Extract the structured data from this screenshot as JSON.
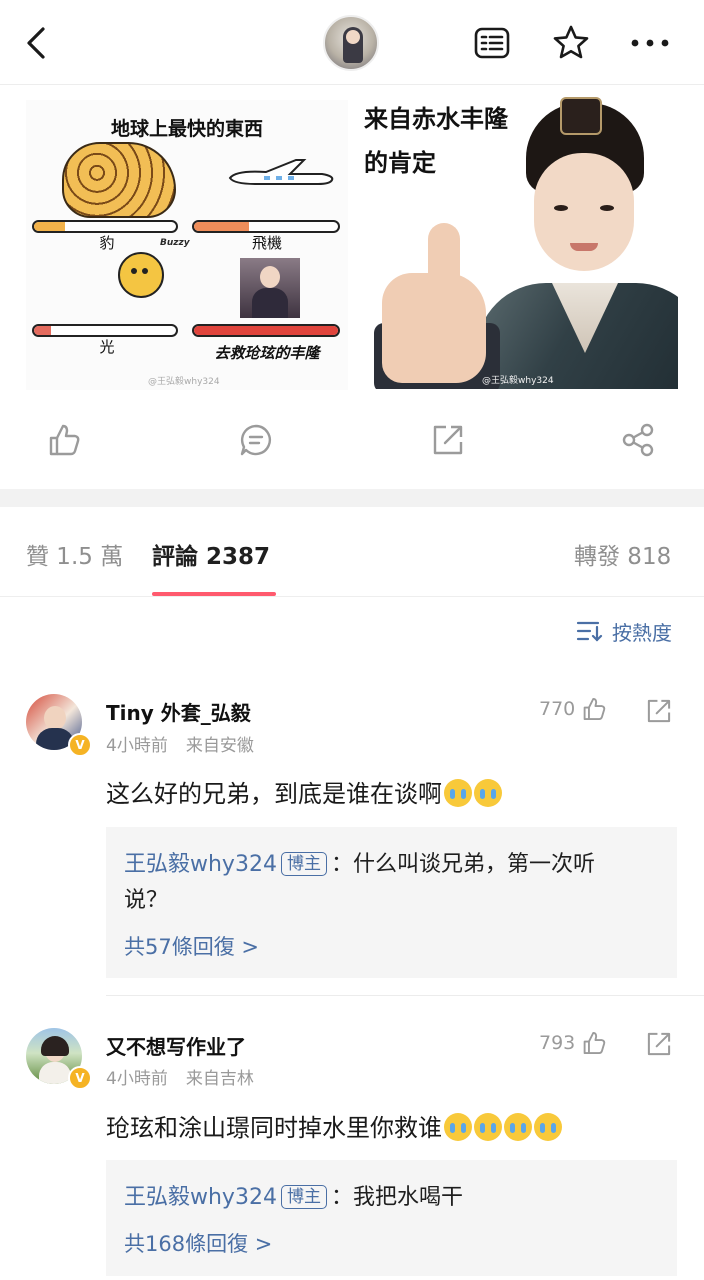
{
  "header": {
    "back_icon": "chevron-left-icon",
    "menu_icons": [
      "reader-icon",
      "star-icon",
      "more-horizontal-icon"
    ]
  },
  "post_images": {
    "left_meme": {
      "title": "地球上最快的東西",
      "labels": [
        "豹",
        "飛機",
        "光",
        "去救玱玹的丰隆"
      ],
      "bar_fill_fractions": [
        0.22,
        0.38,
        0.12,
        1.0
      ],
      "bar_colors": [
        "#f2b24a",
        "#ef8d5a",
        "#e46b5e",
        "#e0443c"
      ],
      "watermark": "@王弘毅why324",
      "tag": "Buzzy"
    },
    "right_meme": {
      "line1": "来自赤水丰隆",
      "line2": "的肯定",
      "watermark": "@王弘毅why324"
    }
  },
  "action_bar": [
    "thumb-up-icon",
    "comment-icon",
    "share-out-icon",
    "share-icon"
  ],
  "tabs": [
    {
      "label": "贊 1.5 萬",
      "active": false
    },
    {
      "label": "評論 2387",
      "active": true
    },
    {
      "label": "轉發 818",
      "active": false
    }
  ],
  "sort": {
    "label": "按熱度",
    "icon": "sort-icon"
  },
  "comments": [
    {
      "user": "Tiny 外套_弘毅",
      "time": "4小時前",
      "location": "来自安徽",
      "likes": "770",
      "text": "这么好的兄弟，到底是谁在谈啊",
      "emoji_count": 2,
      "reply": {
        "user": "王弘毅why324",
        "badge": "博主",
        "text_line1": "：什么叫谈兄弟，第一次听",
        "text_line2": "说？",
        "more": "共57條回復 >"
      }
    },
    {
      "user": "又不想写作业了",
      "time": "4小時前",
      "location": "来自吉林",
      "likes": "793",
      "text": "玱玹和涂山璟同时掉水里你救谁",
      "emoji_count": 4,
      "reply": {
        "user": "王弘毅why324",
        "badge": "博主",
        "text_line1": "：我把水喝干",
        "more": "共168條回復 >"
      }
    }
  ],
  "colors": {
    "accent": "#ff5a6e",
    "link": "#4a6fa5",
    "muted": "#9a9a9a",
    "verified": "#f5b324"
  }
}
